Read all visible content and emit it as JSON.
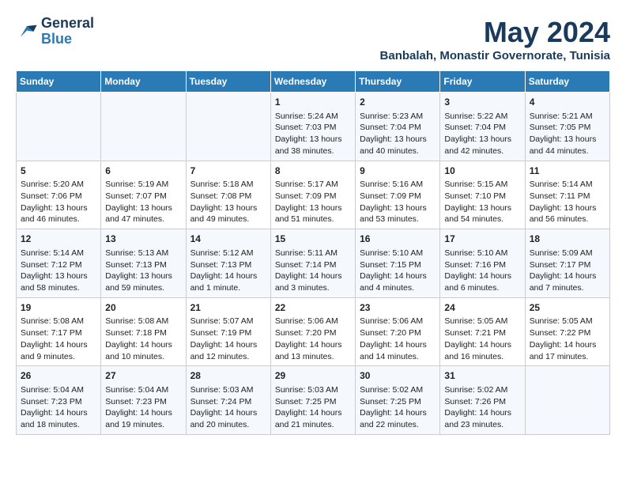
{
  "header": {
    "logo_line1": "General",
    "logo_line2": "Blue",
    "month": "May 2024",
    "location": "Banbalah, Monastir Governorate, Tunisia"
  },
  "weekdays": [
    "Sunday",
    "Monday",
    "Tuesday",
    "Wednesday",
    "Thursday",
    "Friday",
    "Saturday"
  ],
  "weeks": [
    [
      {
        "day": "",
        "info": ""
      },
      {
        "day": "",
        "info": ""
      },
      {
        "day": "",
        "info": ""
      },
      {
        "day": "1",
        "info": "Sunrise: 5:24 AM\nSunset: 7:03 PM\nDaylight: 13 hours\nand 38 minutes."
      },
      {
        "day": "2",
        "info": "Sunrise: 5:23 AM\nSunset: 7:04 PM\nDaylight: 13 hours\nand 40 minutes."
      },
      {
        "day": "3",
        "info": "Sunrise: 5:22 AM\nSunset: 7:04 PM\nDaylight: 13 hours\nand 42 minutes."
      },
      {
        "day": "4",
        "info": "Sunrise: 5:21 AM\nSunset: 7:05 PM\nDaylight: 13 hours\nand 44 minutes."
      }
    ],
    [
      {
        "day": "5",
        "info": "Sunrise: 5:20 AM\nSunset: 7:06 PM\nDaylight: 13 hours\nand 46 minutes."
      },
      {
        "day": "6",
        "info": "Sunrise: 5:19 AM\nSunset: 7:07 PM\nDaylight: 13 hours\nand 47 minutes."
      },
      {
        "day": "7",
        "info": "Sunrise: 5:18 AM\nSunset: 7:08 PM\nDaylight: 13 hours\nand 49 minutes."
      },
      {
        "day": "8",
        "info": "Sunrise: 5:17 AM\nSunset: 7:09 PM\nDaylight: 13 hours\nand 51 minutes."
      },
      {
        "day": "9",
        "info": "Sunrise: 5:16 AM\nSunset: 7:09 PM\nDaylight: 13 hours\nand 53 minutes."
      },
      {
        "day": "10",
        "info": "Sunrise: 5:15 AM\nSunset: 7:10 PM\nDaylight: 13 hours\nand 54 minutes."
      },
      {
        "day": "11",
        "info": "Sunrise: 5:14 AM\nSunset: 7:11 PM\nDaylight: 13 hours\nand 56 minutes."
      }
    ],
    [
      {
        "day": "12",
        "info": "Sunrise: 5:14 AM\nSunset: 7:12 PM\nDaylight: 13 hours\nand 58 minutes."
      },
      {
        "day": "13",
        "info": "Sunrise: 5:13 AM\nSunset: 7:13 PM\nDaylight: 13 hours\nand 59 minutes."
      },
      {
        "day": "14",
        "info": "Sunrise: 5:12 AM\nSunset: 7:13 PM\nDaylight: 14 hours\nand 1 minute."
      },
      {
        "day": "15",
        "info": "Sunrise: 5:11 AM\nSunset: 7:14 PM\nDaylight: 14 hours\nand 3 minutes."
      },
      {
        "day": "16",
        "info": "Sunrise: 5:10 AM\nSunset: 7:15 PM\nDaylight: 14 hours\nand 4 minutes."
      },
      {
        "day": "17",
        "info": "Sunrise: 5:10 AM\nSunset: 7:16 PM\nDaylight: 14 hours\nand 6 minutes."
      },
      {
        "day": "18",
        "info": "Sunrise: 5:09 AM\nSunset: 7:17 PM\nDaylight: 14 hours\nand 7 minutes."
      }
    ],
    [
      {
        "day": "19",
        "info": "Sunrise: 5:08 AM\nSunset: 7:17 PM\nDaylight: 14 hours\nand 9 minutes."
      },
      {
        "day": "20",
        "info": "Sunrise: 5:08 AM\nSunset: 7:18 PM\nDaylight: 14 hours\nand 10 minutes."
      },
      {
        "day": "21",
        "info": "Sunrise: 5:07 AM\nSunset: 7:19 PM\nDaylight: 14 hours\nand 12 minutes."
      },
      {
        "day": "22",
        "info": "Sunrise: 5:06 AM\nSunset: 7:20 PM\nDaylight: 14 hours\nand 13 minutes."
      },
      {
        "day": "23",
        "info": "Sunrise: 5:06 AM\nSunset: 7:20 PM\nDaylight: 14 hours\nand 14 minutes."
      },
      {
        "day": "24",
        "info": "Sunrise: 5:05 AM\nSunset: 7:21 PM\nDaylight: 14 hours\nand 16 minutes."
      },
      {
        "day": "25",
        "info": "Sunrise: 5:05 AM\nSunset: 7:22 PM\nDaylight: 14 hours\nand 17 minutes."
      }
    ],
    [
      {
        "day": "26",
        "info": "Sunrise: 5:04 AM\nSunset: 7:23 PM\nDaylight: 14 hours\nand 18 minutes."
      },
      {
        "day": "27",
        "info": "Sunrise: 5:04 AM\nSunset: 7:23 PM\nDaylight: 14 hours\nand 19 minutes."
      },
      {
        "day": "28",
        "info": "Sunrise: 5:03 AM\nSunset: 7:24 PM\nDaylight: 14 hours\nand 20 minutes."
      },
      {
        "day": "29",
        "info": "Sunrise: 5:03 AM\nSunset: 7:25 PM\nDaylight: 14 hours\nand 21 minutes."
      },
      {
        "day": "30",
        "info": "Sunrise: 5:02 AM\nSunset: 7:25 PM\nDaylight: 14 hours\nand 22 minutes."
      },
      {
        "day": "31",
        "info": "Sunrise: 5:02 AM\nSunset: 7:26 PM\nDaylight: 14 hours\nand 23 minutes."
      },
      {
        "day": "",
        "info": ""
      }
    ]
  ]
}
